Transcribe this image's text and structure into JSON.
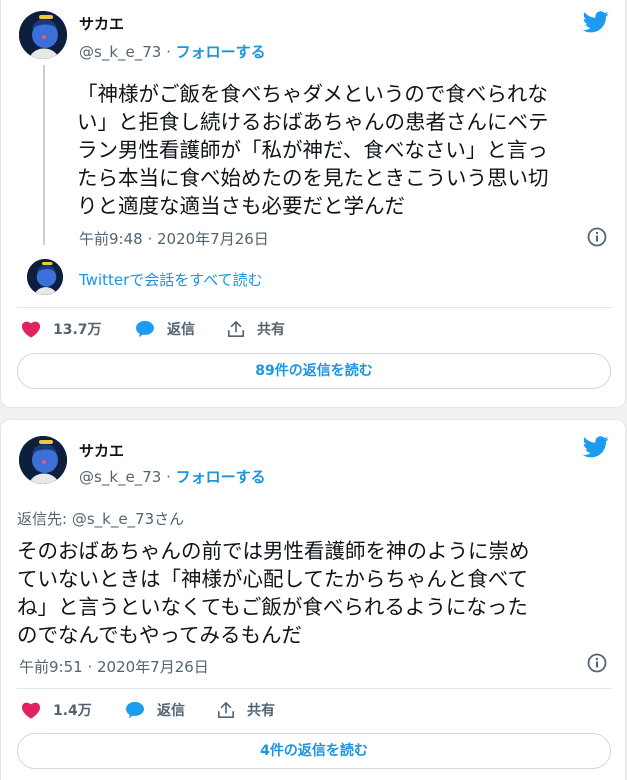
{
  "colors": {
    "accent": "#1b95e0",
    "like": "#e0245e",
    "muted": "#536471",
    "border": "#e1e8ed"
  },
  "tweets": [
    {
      "display_name": "サカエ",
      "handle": "@s_k_e_73",
      "separator": " · ",
      "follow_label": "フォローする",
      "text_lines": [
        "「神様がご飯を食べちゃダメというので食べられな",
        "い」と拒食し続けるおばあちゃんの患者さんにベテ",
        "ラン男性看護師が「私が神だ、食べなさい」と言っ",
        "たら本当に食べ始めたのを見たときこういう思い切",
        "りと適度な適当さも必要だと学んだ"
      ],
      "timestamp": "午前9:48 · 2020年7月26日",
      "conversation_link": "Twitterで会話をすべて読む",
      "likes": "13.7万",
      "reply_label": "返信",
      "share_label": "共有",
      "read_replies": "89件の返信を読む",
      "icons": [
        "twitter-bird-icon",
        "info-icon",
        "heart-icon",
        "reply-bubble-icon",
        "share-icon"
      ]
    },
    {
      "display_name": "サカエ",
      "handle": "@s_k_e_73",
      "separator": " · ",
      "follow_label": "フォローする",
      "reply_to": "返信先: @s_k_e_73さん",
      "text_lines": [
        "そのおばあちゃんの前では男性看護師を神のように崇め",
        "ていないときは「神様が心配してたからちゃんと食べて",
        "ね」と言うといなくてもご飯が食べられるようになった",
        "のでなんでもやってみるもんだ"
      ],
      "timestamp": "午前9:51 · 2020年7月26日",
      "likes": "1.4万",
      "reply_label": "返信",
      "share_label": "共有",
      "read_replies": "4件の返信を読む"
    }
  ]
}
